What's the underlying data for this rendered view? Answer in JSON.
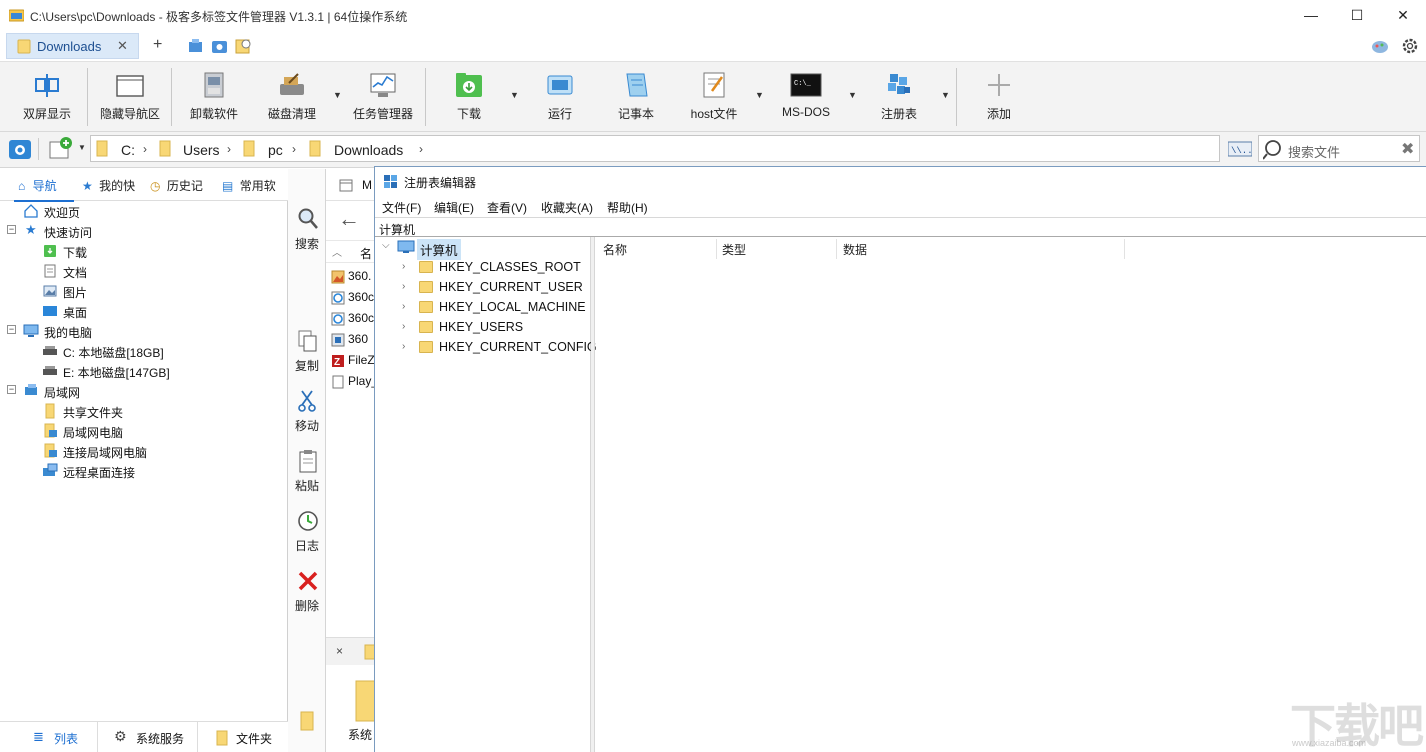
{
  "window": {
    "title": "C:\\Users\\pc\\Downloads - 极客多标签文件管理器 V1.3.1  |  64位操作系统",
    "buttons": {
      "minimize": "—",
      "maximize": "☐",
      "close": "✕"
    }
  },
  "tabs": {
    "active_label": "Downloads",
    "close": "✕",
    "add": "+"
  },
  "ribbon": {
    "items": [
      {
        "label": "双屏显示",
        "icon": "split-screen-icon"
      },
      {
        "label": "隐藏导航区",
        "icon": "hide-nav-icon"
      },
      {
        "label": "卸载软件",
        "icon": "uninstall-icon"
      },
      {
        "label": "磁盘清理",
        "icon": "disk-cleanup-icon"
      },
      {
        "label": "任务管理器",
        "icon": "task-manager-icon"
      },
      {
        "label": "下载",
        "icon": "download-icon"
      },
      {
        "label": "运行",
        "icon": "run-icon"
      },
      {
        "label": "记事本",
        "icon": "notepad-icon"
      },
      {
        "label": "host文件",
        "icon": "host-file-icon"
      },
      {
        "label": "MS-DOS",
        "icon": "msdos-icon"
      },
      {
        "label": "注册表",
        "icon": "registry-icon"
      },
      {
        "label": "添加",
        "icon": "add-icon"
      }
    ]
  },
  "address": {
    "crumbs": [
      "C:",
      "Users",
      "pc",
      "Downloads"
    ],
    "search_placeholder": "搜索文件"
  },
  "nav": {
    "tabs": [
      "导航",
      "我的快",
      "历史记",
      "常用软"
    ],
    "tree": [
      {
        "label": "欢迎页",
        "level": 0,
        "expander": ""
      },
      {
        "label": "快速访问",
        "level": 0,
        "expander": "−"
      },
      {
        "label": "下载",
        "level": 1,
        "expander": ""
      },
      {
        "label": "文档",
        "level": 1,
        "expander": ""
      },
      {
        "label": "图片",
        "level": 1,
        "expander": ""
      },
      {
        "label": "桌面",
        "level": 1,
        "expander": ""
      },
      {
        "label": "我的电脑",
        "level": 0,
        "expander": "−"
      },
      {
        "label": "C: 本地磁盘[18GB]",
        "level": 1,
        "expander": ""
      },
      {
        "label": "E: 本地磁盘[147GB]",
        "level": 1,
        "expander": ""
      },
      {
        "label": "局域网",
        "level": 0,
        "expander": "−"
      },
      {
        "label": "共享文件夹",
        "level": 1,
        "expander": ""
      },
      {
        "label": "局域网电脑",
        "level": 1,
        "expander": ""
      },
      {
        "label": "连接局域网电脑",
        "level": 1,
        "expander": ""
      },
      {
        "label": "远程桌面连接",
        "level": 1,
        "expander": ""
      }
    ],
    "bottom_tabs": [
      "列表",
      "系统服务",
      "文件夹"
    ]
  },
  "actions": [
    "搜索",
    "复制",
    "移动",
    "粘贴",
    "日志",
    "删除"
  ],
  "filelist": {
    "tab_label": "M",
    "column": "名",
    "files": [
      "360.",
      "360c",
      "360c",
      "360",
      "FileZ",
      "Play_"
    ],
    "bottom_tab_close": "×",
    "bottom_folder": "系统"
  },
  "regedit": {
    "title": "注册表编辑器",
    "menu": [
      "文件(F)",
      "编辑(E)",
      "查看(V)",
      "收藏夹(A)",
      "帮助(H)"
    ],
    "address": "计算机",
    "root": "计算机",
    "keys": [
      "HKEY_CLASSES_ROOT",
      "HKEY_CURRENT_USER",
      "HKEY_LOCAL_MACHINE",
      "HKEY_USERS",
      "HKEY_CURRENT_CONFIG"
    ],
    "columns": [
      "名称",
      "类型",
      "数据"
    ]
  },
  "watermark": {
    "main": "下载吧",
    "sub": "www.xiazaiba.com"
  },
  "colors": {
    "accent": "#1d6fd1",
    "tab_bg": "#dbe9f8",
    "ribbon_bg": "#f3f3f3",
    "folder": "#f8d775"
  }
}
